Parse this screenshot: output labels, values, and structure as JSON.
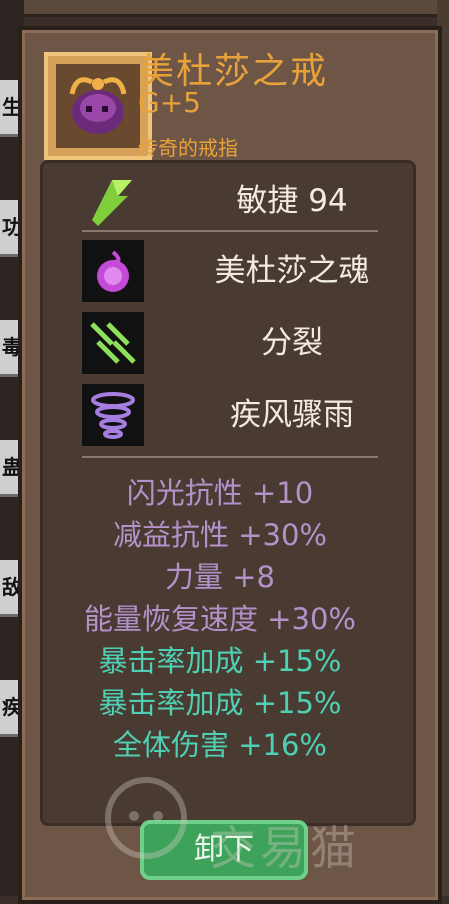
{
  "item": {
    "name": "美杜莎之戒",
    "level": "G+5",
    "rarity": "传奇的戒指",
    "icon": "medusa-ring-icon"
  },
  "attributes": [
    {
      "label": "敏捷 94",
      "icon": "agility-icon"
    }
  ],
  "abilities": [
    {
      "label": "美杜莎之魂",
      "icon": "medusa-soul-icon"
    },
    {
      "label": "分裂",
      "icon": "split-icon"
    },
    {
      "label": "疾风骤雨",
      "icon": "storm-icon"
    }
  ],
  "stats": [
    {
      "text": "闪光抗性 +10",
      "color": "#b491c9"
    },
    {
      "text": "减益抗性 +30%",
      "color": "#b491c9"
    },
    {
      "text": "力量 +8",
      "color": "#b491c9"
    },
    {
      "text": "能量恢复速度 +30%",
      "color": "#b491c9"
    },
    {
      "text": "暴击率加成 +15%",
      "color": "#4fd0b4"
    },
    {
      "text": "暴击率加成 +15%",
      "color": "#4fd0b4"
    },
    {
      "text": "全体伤害 +16%",
      "color": "#4fd0b4"
    }
  ],
  "actions": {
    "unequip": "卸下"
  },
  "left_list": [
    "",
    "生",
    "功",
    "毒",
    "蛊",
    "敌",
    "疾"
  ],
  "watermark": "交易猫",
  "colors": {
    "title": "#e9a23a",
    "panel": "#6e5646",
    "button": "#3fa25a"
  }
}
